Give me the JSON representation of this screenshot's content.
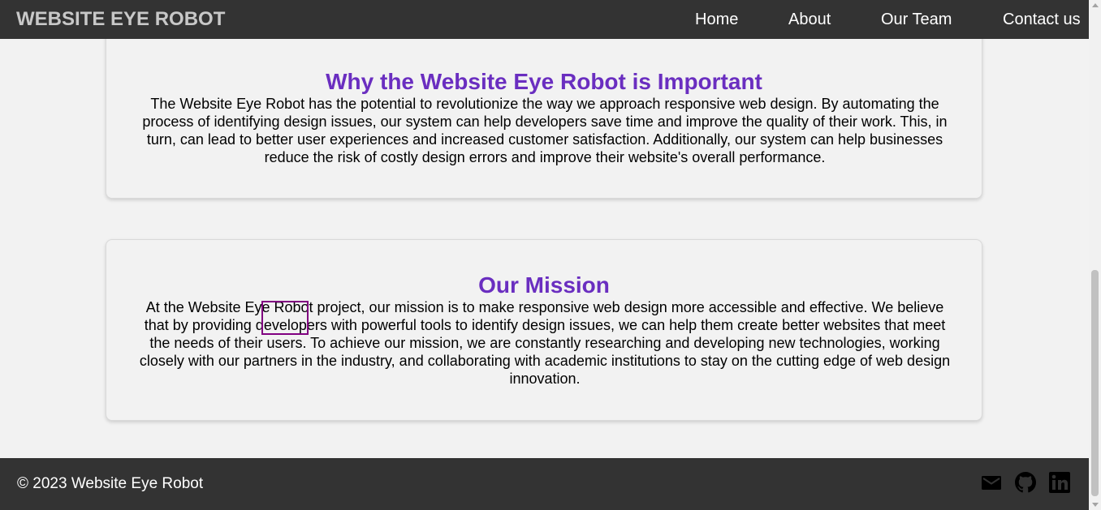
{
  "navbar": {
    "brand": "WEBSITE EYE ROBOT",
    "links": [
      "Home",
      "About",
      "Our Team",
      "Contact us"
    ]
  },
  "sections": [
    {
      "title": "Why the Website Eye Robot is Important",
      "body": "The Website Eye Robot has the potential to revolutionize the way we approach responsive web design. By automating the process of identifying design issues, our system can help developers save time and improve the quality of their work. This, in turn, can lead to better user experiences and increased customer satisfaction. Additionally, our system can help businesses reduce the risk of costly design errors and improve their website's overall performance."
    },
    {
      "title": "Our Mission",
      "body": "At the Website Eye Robot project, our mission is to make responsive web design more accessible and effective. We believe that by providing developers with powerful tools to identify design issues, we can help them create better websites that meet the needs of their users. To achieve our mission, we are constantly researching and developing new technologies, working closely with our partners in the industry, and collaborating with academic institutions to stay on the cutting edge of web design innovation."
    }
  ],
  "footer": {
    "copyright": "© 2023 Website Eye Robot",
    "icons": [
      "mail-icon",
      "github-icon",
      "linkedin-icon"
    ]
  },
  "colors": {
    "nav_background": "#333333",
    "brand_text": "#c8c8c8",
    "heading": "#6a2ec0",
    "page_background": "#f2f2f2",
    "highlight_box": "#800080"
  }
}
